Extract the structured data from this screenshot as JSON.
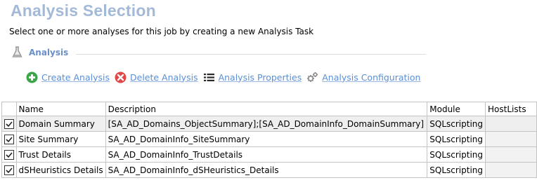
{
  "page": {
    "title": "Analysis Selection",
    "subtitle": "Select one or more analyses for this job by creating a new Analysis Task"
  },
  "section": {
    "label": "Analysis",
    "icon": "flask-icon"
  },
  "toolbar": {
    "create": {
      "label": "Create Analysis",
      "icon": "add-icon",
      "color": "#3aa648"
    },
    "delete": {
      "label": "Delete Analysis",
      "icon": "delete-icon",
      "color": "#e04848"
    },
    "properties": {
      "label": "Analysis Properties",
      "icon": "list-icon"
    },
    "configuration": {
      "label": "Analysis Configuration",
      "icon": "gears-icon"
    }
  },
  "grid": {
    "columns": [
      "Name",
      "Description",
      "Module",
      "HostLists"
    ],
    "rows": [
      {
        "checked": true,
        "name": "Domain Summary",
        "description": "[SA_AD_Domains_ObjectSummary];[SA_AD_DomainInfo_DomainSummary]",
        "module": "SQLscripting",
        "hostlists": ""
      },
      {
        "checked": true,
        "name": "Site Summary",
        "description": "SA_AD_DomainInfo_SiteSummary",
        "module": "SQLscripting",
        "hostlists": ""
      },
      {
        "checked": true,
        "name": "Trust Details",
        "description": "SA_AD_DomainInfo_TrustDetails",
        "module": "SQLscripting",
        "hostlists": ""
      },
      {
        "checked": true,
        "name": "dSHeuristics Details",
        "description": "SA_AD_DomainInfo_dSHeuristics_Details",
        "module": "SQLscripting",
        "hostlists": ""
      }
    ]
  }
}
